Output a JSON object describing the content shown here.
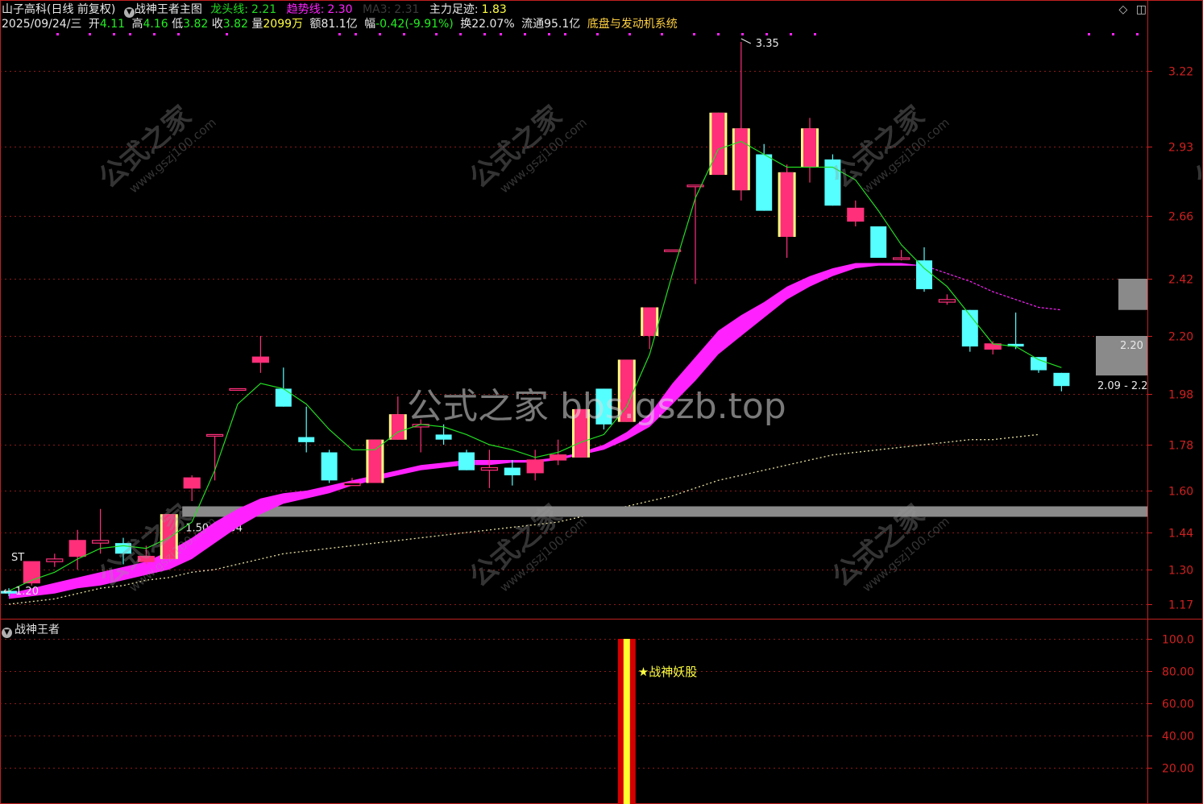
{
  "header": {
    "stock": "山子高科(日线 前复权)",
    "indicator_main": "战神王者主图",
    "dragon_label": "龙头线:",
    "dragon_value": "2.21",
    "trend_label": "趋势线:",
    "trend_value": "2.30",
    "ma_label": "MA3:",
    "ma_value": "2.31",
    "main_force_label": "主力足迹:",
    "main_force_value": "1.83",
    "date": "2025/09/24/三",
    "open_label": "开",
    "open_value": "4.11",
    "high_label": "高",
    "high_value": "4.16",
    "low_label": "低",
    "low_value": "3.82",
    "close_label": "收",
    "close_value": "3.82",
    "volume_label": "量",
    "volume_value": "2099万",
    "amount_label": "额",
    "amount_value": "81.1亿",
    "change_label": "幅",
    "change_value": "-0.42(-9.91%)",
    "turnover_label": "换",
    "turnover_value": "22.07%",
    "float_label": "流通",
    "float_value": "95.1亿",
    "system_name": "底盘与发动机系统"
  },
  "sub_panel": {
    "title": "战神王者",
    "signal_label": "★战神妖股"
  },
  "watermark": {
    "caption": "公式之家 bbs.gszb.top",
    "logo_text": "公式之家",
    "logo_url": "www.gszj100.com"
  },
  "colors": {
    "up": "#ff2f7a",
    "down": "#55ffff",
    "dragon_line": "#22dd22",
    "trend_band": "#ff22ff",
    "main_force": "#e8e0a0",
    "axis": "#d02020",
    "grid": "#8a1a1a",
    "support_band": "#8a8a8a",
    "signal_bar": "#d40000",
    "signal_core": "#ffff30"
  },
  "chart_data": [
    {
      "type": "candlestick",
      "title": "战神王者主图",
      "y_ticks": [
        "3.22",
        "2.93",
        "2.66",
        "2.42",
        "2.20",
        "1.98",
        "1.78",
        "1.60",
        "1.44",
        "1.30",
        "1.17"
      ],
      "candles": [
        {
          "o": 1.22,
          "h": 1.23,
          "l": 1.2,
          "c": 1.21
        },
        {
          "o": 1.25,
          "h": 1.33,
          "l": 1.24,
          "c": 1.33
        },
        {
          "o": 1.33,
          "h": 1.36,
          "l": 1.31,
          "c": 1.34
        },
        {
          "o": 1.35,
          "h": 1.45,
          "l": 1.3,
          "c": 1.41
        },
        {
          "o": 1.4,
          "h": 1.53,
          "l": 1.36,
          "c": 1.41
        },
        {
          "o": 1.4,
          "h": 1.42,
          "l": 1.32,
          "c": 1.36
        },
        {
          "o": 1.33,
          "h": 1.39,
          "l": 1.32,
          "c": 1.35
        },
        {
          "o": 1.34,
          "h": 1.51,
          "l": 1.34,
          "c": 1.51
        },
        {
          "o": 1.61,
          "h": 1.66,
          "l": 1.56,
          "c": 1.65
        },
        {
          "o": 1.82,
          "h": 1.82,
          "l": 1.64,
          "c": 1.82
        },
        {
          "o": 2.0,
          "h": 2.0,
          "l": 2.0,
          "c": 2.0
        },
        {
          "o": 2.1,
          "h": 2.2,
          "l": 2.06,
          "c": 2.12
        },
        {
          "o": 2.0,
          "h": 2.08,
          "l": 1.93,
          "c": 1.93
        },
        {
          "o": 1.81,
          "h": 1.93,
          "l": 1.75,
          "c": 1.79
        },
        {
          "o": 1.75,
          "h": 1.76,
          "l": 1.63,
          "c": 1.64
        },
        {
          "o": 1.62,
          "h": 1.65,
          "l": 1.62,
          "c": 1.63
        },
        {
          "o": 1.63,
          "h": 1.8,
          "l": 1.63,
          "c": 1.8
        },
        {
          "o": 1.8,
          "h": 1.97,
          "l": 1.8,
          "c": 1.9
        },
        {
          "o": 1.85,
          "h": 1.88,
          "l": 1.75,
          "c": 1.86
        },
        {
          "o": 1.82,
          "h": 1.86,
          "l": 1.78,
          "c": 1.8
        },
        {
          "o": 1.75,
          "h": 1.76,
          "l": 1.68,
          "c": 1.68
        },
        {
          "o": 1.68,
          "h": 1.76,
          "l": 1.61,
          "c": 1.69
        },
        {
          "o": 1.69,
          "h": 1.72,
          "l": 1.62,
          "c": 1.66
        },
        {
          "o": 1.67,
          "h": 1.76,
          "l": 1.64,
          "c": 1.72
        },
        {
          "o": 1.72,
          "h": 1.8,
          "l": 1.7,
          "c": 1.74
        },
        {
          "o": 1.73,
          "h": 1.92,
          "l": 1.73,
          "c": 1.92
        },
        {
          "o": 2.0,
          "h": 2.0,
          "l": 1.84,
          "c": 1.86
        },
        {
          "o": 1.87,
          "h": 2.11,
          "l": 1.87,
          "c": 2.11
        },
        {
          "o": 2.2,
          "h": 2.31,
          "l": 2.15,
          "c": 2.31
        },
        {
          "o": 2.53,
          "h": 2.53,
          "l": 2.53,
          "c": 2.53
        },
        {
          "o": 2.78,
          "h": 2.78,
          "l": 2.4,
          "c": 2.78
        },
        {
          "o": 2.82,
          "h": 3.06,
          "l": 2.82,
          "c": 3.06
        },
        {
          "o": 2.76,
          "h": 3.35,
          "l": 2.72,
          "c": 3.0
        },
        {
          "o": 2.9,
          "h": 2.94,
          "l": 2.68,
          "c": 2.68
        },
        {
          "o": 2.58,
          "h": 2.86,
          "l": 2.5,
          "c": 2.83
        },
        {
          "o": 2.85,
          "h": 3.04,
          "l": 2.79,
          "c": 3.0
        },
        {
          "o": 2.88,
          "h": 2.9,
          "l": 2.7,
          "c": 2.7
        },
        {
          "o": 2.64,
          "h": 2.72,
          "l": 2.62,
          "c": 2.69
        },
        {
          "o": 2.62,
          "h": 2.62,
          "l": 2.5,
          "c": 2.5
        },
        {
          "o": 2.5,
          "h": 2.53,
          "l": 2.49,
          "c": 2.5
        },
        {
          "o": 2.49,
          "h": 2.54,
          "l": 2.37,
          "c": 2.38
        },
        {
          "o": 2.33,
          "h": 2.36,
          "l": 2.32,
          "c": 2.34
        },
        {
          "o": 2.3,
          "h": 2.3,
          "l": 2.14,
          "c": 2.16
        },
        {
          "o": 2.15,
          "h": 2.18,
          "l": 2.13,
          "c": 2.17
        },
        {
          "o": 2.17,
          "h": 2.29,
          "l": 2.15,
          "c": 2.16
        },
        {
          "o": 2.12,
          "h": 2.12,
          "l": 2.06,
          "c": 2.07
        },
        {
          "o": 2.06,
          "h": 2.06,
          "l": 1.99,
          "c": 2.01
        }
      ],
      "dragon_line": [
        1.22,
        1.26,
        1.29,
        1.34,
        1.38,
        1.39,
        1.38,
        1.42,
        1.48,
        1.68,
        1.94,
        2.02,
        2.0,
        1.94,
        1.84,
        1.76,
        1.76,
        1.83,
        1.86,
        1.85,
        1.82,
        1.78,
        1.76,
        1.73,
        1.75,
        1.79,
        1.82,
        1.93,
        2.13,
        2.44,
        2.73,
        2.92,
        2.95,
        2.9,
        2.85,
        2.85,
        2.85,
        2.8,
        2.68,
        2.55,
        2.46,
        2.39,
        2.28,
        2.17,
        2.16,
        2.11,
        2.08
      ],
      "trend_band_upper": [
        1.21,
        1.23,
        1.25,
        1.27,
        1.29,
        1.31,
        1.33,
        1.37,
        1.42,
        1.48,
        1.53,
        1.57,
        1.59,
        1.6,
        1.62,
        1.64,
        1.66,
        1.68,
        1.7,
        1.71,
        1.72,
        1.72,
        1.72,
        1.72,
        1.73,
        1.75,
        1.78,
        1.83,
        1.9,
        2.02,
        2.12,
        2.22,
        2.28,
        2.33,
        2.39,
        2.43,
        2.46,
        2.48,
        2.48,
        2.48,
        2.47
      ],
      "trend_band_lower": [
        1.19,
        1.2,
        1.21,
        1.23,
        1.24,
        1.26,
        1.28,
        1.3,
        1.34,
        1.4,
        1.46,
        1.51,
        1.55,
        1.57,
        1.59,
        1.62,
        1.64,
        1.66,
        1.68,
        1.69,
        1.7,
        1.7,
        1.71,
        1.71,
        1.72,
        1.74,
        1.76,
        1.8,
        1.85,
        1.94,
        2.03,
        2.13,
        2.2,
        2.27,
        2.34,
        2.39,
        2.43,
        2.46,
        2.47,
        2.47,
        2.47
      ],
      "trend_tail": [
        2.47,
        2.44,
        2.41,
        2.37,
        2.34,
        2.31,
        2.3
      ],
      "main_force": [
        1.17,
        1.18,
        1.19,
        1.21,
        1.23,
        1.24,
        1.26,
        1.27,
        1.29,
        1.3,
        1.32,
        1.34,
        1.36,
        1.37,
        1.38,
        1.39,
        1.4,
        1.41,
        1.42,
        1.43,
        1.44,
        1.45,
        1.46,
        1.47,
        1.48,
        1.5,
        1.52,
        1.54,
        1.56,
        1.58,
        1.61,
        1.64,
        1.66,
        1.68,
        1.7,
        1.72,
        1.74,
        1.75,
        1.76,
        1.77,
        1.78,
        1.79,
        1.8,
        1.8,
        1.81,
        1.82
      ],
      "support_band": {
        "low": 1.5,
        "high": 1.54,
        "label": "1.50 - 1.54",
        "start_index": 8
      },
      "annotations": [
        {
          "text": "3.35",
          "index": 32,
          "price": 3.35
        },
        {
          "text": "1.20",
          "index": 0,
          "price": 1.2
        },
        {
          "text": "ST",
          "index": 0,
          "price": 1.34
        },
        {
          "text": "2.20",
          "index": 46,
          "price": 2.2
        },
        {
          "text": "2.09 - 2.2",
          "index": 46,
          "price": 2.05
        }
      ]
    },
    {
      "type": "bar",
      "title": "战神王者",
      "y_ticks": [
        "100.0",
        "80.00",
        "60.00",
        "40.00",
        "20.00"
      ],
      "signal_index": 27,
      "signal_value": 100
    }
  ]
}
